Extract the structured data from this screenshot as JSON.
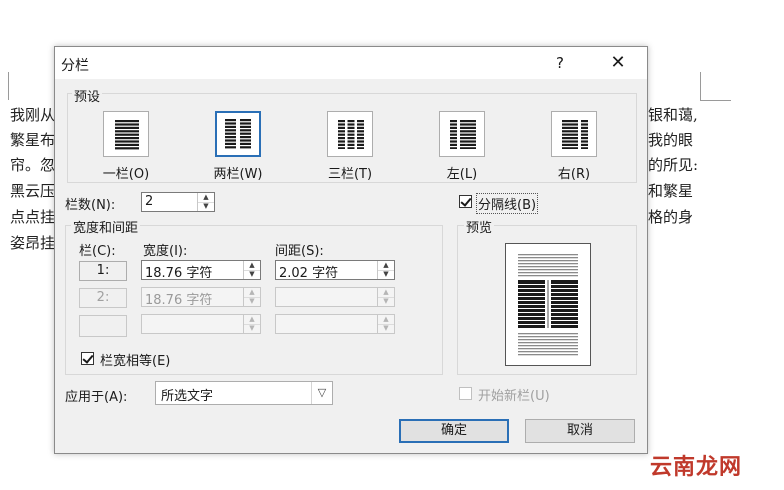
{
  "document": {
    "left_lines": [
      "我刚从",
      "繁星布",
      "帘。忽",
      "黑云压",
      "点点挂",
      "姿昂挂"
    ],
    "right_lines": [
      "银和蔼,",
      "我的眼",
      "的所见:",
      "和繁星",
      "格的身",
      ""
    ]
  },
  "dialog": {
    "title": "分栏",
    "help_label": "?",
    "close_label": "✕",
    "presets_label": "预设",
    "presets": [
      {
        "label": "一栏(O)",
        "icon": "one-column-icon",
        "selected": false
      },
      {
        "label": "两栏(W)",
        "icon": "two-columns-icon",
        "selected": true
      },
      {
        "label": "三栏(T)",
        "icon": "three-columns-icon",
        "selected": false
      },
      {
        "label": "左(L)",
        "icon": "left-column-icon",
        "selected": false
      },
      {
        "label": "右(R)",
        "icon": "right-column-icon",
        "selected": false
      }
    ],
    "num_columns_label": "栏数(N):",
    "num_columns_value": "2",
    "divider_label": "分隔线(B)",
    "divider_checked": true,
    "width_spacing_label": "宽度和间距",
    "col_header": "栏(C):",
    "width_header": "宽度(I):",
    "spacing_header": "间距(S):",
    "rows": [
      {
        "col": "1:",
        "width": "18.76 字符",
        "spacing": "2.02 字符",
        "enabled": true
      },
      {
        "col": "2:",
        "width": "18.76 字符",
        "spacing": "",
        "enabled": false
      },
      {
        "col": "",
        "width": "",
        "spacing": "",
        "enabled": false
      }
    ],
    "equal_width_label": "栏宽相等(E)",
    "equal_width_checked": true,
    "preview_label": "预览",
    "apply_to_label": "应用于(A):",
    "apply_to_value": "所选文字",
    "new_column_label": "开始新栏(U)",
    "new_column_checked": false,
    "ok_label": "确定",
    "cancel_label": "取消"
  },
  "watermark": "云南龙网"
}
